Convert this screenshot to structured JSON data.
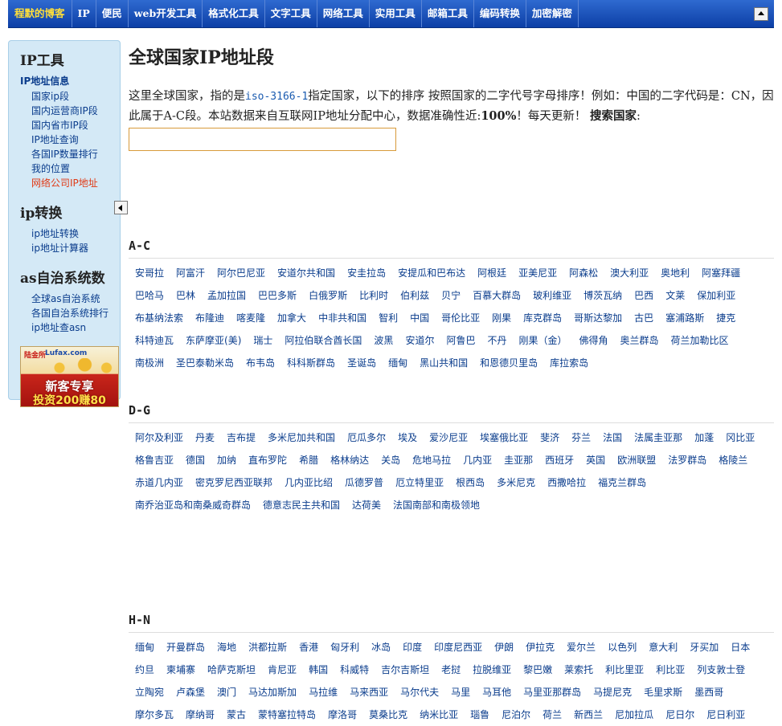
{
  "nav": {
    "brand": "程默的博客",
    "items": [
      "IP",
      "便民",
      "web开发工具",
      "格式化工具",
      "文字工具",
      "网络工具",
      "实用工具",
      "邮箱工具",
      "编码转换",
      "加密解密"
    ]
  },
  "sidebar": {
    "sections": [
      {
        "title": "IP工具",
        "subtitle": "IP地址信息",
        "items": [
          "国家ip段",
          "国内运营商IP段",
          "国内省市IP段",
          "IP地址查询",
          "各国IP数量排行",
          "我的位置",
          "网络公司IP地址"
        ],
        "active": 6
      },
      {
        "title": "ip转换",
        "subtitle": "",
        "items": [
          "ip地址转换",
          "ip地址计算器"
        ],
        "active": -1
      },
      {
        "title": "as自治系统数",
        "subtitle": "",
        "items": [
          "全球as自治系统",
          "各国自治系统排行",
          "ip地址查asn"
        ],
        "active": -1
      }
    ],
    "ad": {
      "logo": "陆金所",
      "logo2": "Lufax.com",
      "line1": "新客专享",
      "line2": "投资200赚80"
    }
  },
  "main": {
    "title": "全球国家IP地址段",
    "intro_a": "这里全球国家，指的是",
    "intro_code": "iso-3166-1",
    "intro_b": "指定国家，以下的排序 按照国家的二字代号字母排序！例如：中国的二字代码是：CN，因此属于A-C段。本站数据来自互联网IP地址分配中心，数据准确性近:",
    "intro_pct": "100%",
    "intro_c": "！每天更新！",
    "intro_search": "搜索国家",
    "intro_colon": ":"
  },
  "groups": [
    {
      "title": "A-C",
      "countries": [
        "安哥拉",
        "阿富汗",
        "阿尔巴尼亚",
        "安道尔共和国",
        "安圭拉岛",
        "安提瓜和巴布达",
        "阿根廷",
        "亚美尼亚",
        "阿森松",
        "澳大利亚",
        "奥地利",
        "阿塞拜疆",
        "巴哈马",
        "巴林",
        "孟加拉国",
        "巴巴多斯",
        "白俄罗斯",
        "比利时",
        "伯利兹",
        "贝宁",
        "百慕大群岛",
        "玻利维亚",
        "博茨瓦纳",
        "巴西",
        "文莱",
        "保加利亚",
        "布基纳法索",
        "布隆迪",
        "喀麦隆",
        "加拿大",
        "中非共和国",
        "智利",
        "中国",
        "哥伦比亚",
        "刚果",
        "库克群岛",
        "哥斯达黎加",
        "古巴",
        "塞浦路斯",
        "捷克",
        "科特迪瓦",
        "东萨摩亚(美)",
        "瑞士",
        "阿拉伯联合酋长国",
        "波黑",
        "安道尔",
        "阿鲁巴",
        "不丹",
        "刚果（金）",
        "佛得角",
        "奥兰群岛",
        "荷兰加勒比区",
        "南极洲",
        "圣巴泰勒米岛",
        "布韦岛",
        "科科斯群岛",
        "圣诞岛",
        "缅甸",
        "黑山共和国",
        "和恩德贝里岛",
        "库拉索岛"
      ]
    },
    {
      "title": "D-G",
      "countries": [
        "阿尔及利亚",
        "丹麦",
        "吉布提",
        "多米尼加共和国",
        "厄瓜多尔",
        "埃及",
        "爱沙尼亚",
        "埃塞俄比亚",
        "斐济",
        "芬兰",
        "法国",
        "法属圭亚那",
        "加蓬",
        "冈比亚",
        "格鲁吉亚",
        "德国",
        "加纳",
        "直布罗陀",
        "希腊",
        "格林纳达",
        "关岛",
        "危地马拉",
        "几内亚",
        "圭亚那",
        "西班牙",
        "英国",
        "欧洲联盟",
        "法罗群岛",
        "格陵兰",
        "赤道几内亚",
        "密克罗尼西亚联邦",
        "几内亚比绍",
        "瓜德罗普",
        "厄立特里亚",
        "根西岛",
        "多米尼克",
        "西撒哈拉",
        "福克兰群岛",
        "南乔治亚岛和南桑威奇群岛",
        "德意志民主共和国",
        "达荷美",
        "法国南部和南极领地"
      ]
    },
    {
      "title": "H-N",
      "countries": [
        "缅甸",
        "开曼群岛",
        "海地",
        "洪都拉斯",
        "香港",
        "匈牙利",
        "冰岛",
        "印度",
        "印度尼西亚",
        "伊朗",
        "伊拉克",
        "爱尔兰",
        "以色列",
        "意大利",
        "牙买加",
        "日本",
        "约旦",
        "柬埔寨",
        "哈萨克斯坦",
        "肯尼亚",
        "韩国",
        "科威特",
        "吉尔吉斯坦",
        "老挝",
        "拉脱维亚",
        "黎巴嫩",
        "莱索托",
        "利比里亚",
        "利比亚",
        "列支敦士登",
        "立陶宛",
        "卢森堡",
        "澳门",
        "马达加斯加",
        "马拉维",
        "马来西亚",
        "马尔代夫",
        "马里",
        "马耳他",
        "马里亚那群岛",
        "马提尼克",
        "毛里求斯",
        "墨西哥",
        "摩尔多瓦",
        "摩纳哥",
        "蒙古",
        "蒙特塞拉特岛",
        "摩洛哥",
        "莫桑比克",
        "纳米比亚",
        "瑙鲁",
        "尼泊尔",
        "荷兰",
        "新西兰",
        "尼加拉瓜",
        "尼日尔",
        "尼日利亚"
      ]
    }
  ]
}
